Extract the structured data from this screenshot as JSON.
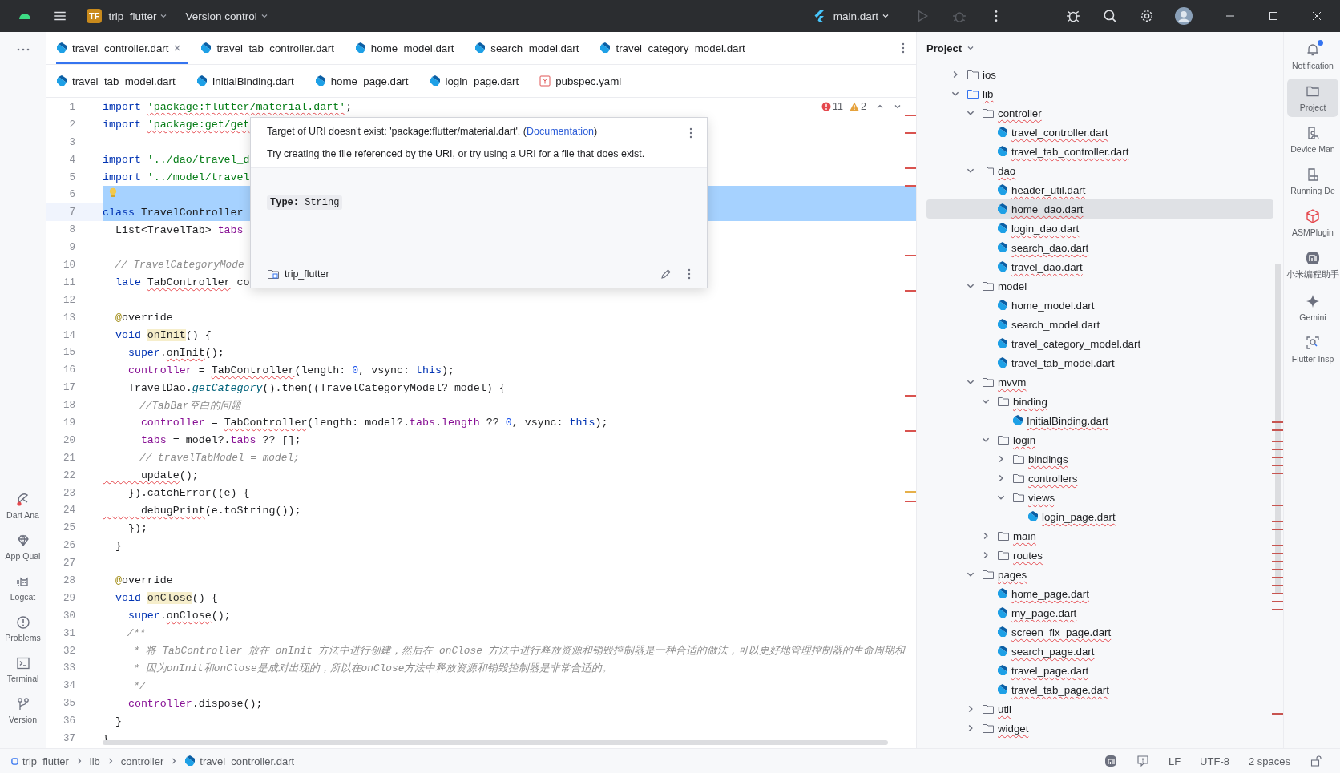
{
  "title_bar": {
    "project_badge": "TF",
    "project": "trip_flutter",
    "vcs": "Version control",
    "run_config": "main.dart"
  },
  "tab_rows": [
    {
      "tabs": [
        {
          "label": "travel_controller.dart",
          "kind": "dart",
          "selected": true
        },
        {
          "label": "travel_tab_controller.dart",
          "kind": "dart",
          "selected": false
        },
        {
          "label": "home_model.dart",
          "kind": "dart",
          "selected": false
        },
        {
          "label": "search_model.dart",
          "kind": "dart",
          "selected": false
        },
        {
          "label": "travel_category_model.dart",
          "kind": "dart",
          "selected": false
        }
      ]
    },
    {
      "tabs": [
        {
          "label": "travel_tab_model.dart",
          "kind": "dart",
          "selected": false
        },
        {
          "label": "InitialBinding.dart",
          "kind": "dart",
          "selected": false
        },
        {
          "label": "home_page.dart",
          "kind": "dart",
          "selected": false
        },
        {
          "label": "login_page.dart",
          "kind": "dart",
          "selected": false
        },
        {
          "label": "pubspec.yaml",
          "kind": "yaml",
          "selected": false
        }
      ]
    }
  ],
  "left_toolbar": [
    {
      "label": "Dart Ana",
      "kind": "analysis"
    },
    {
      "label": "App Qual",
      "kind": "quality"
    },
    {
      "label": "Logcat",
      "kind": "logcat"
    },
    {
      "label": "Problems",
      "kind": "problems"
    },
    {
      "label": "Terminal",
      "kind": "terminal"
    },
    {
      "label": "Version",
      "kind": "vcs"
    }
  ],
  "editor": {
    "problems": {
      "errors": "11",
      "warnings": "2"
    },
    "lines": [
      {
        "number": "1",
        "selected": false,
        "segments": [
          {
            "text": "import ",
            "kind": "keyword"
          },
          {
            "text": "'package:flutter/material.dart'",
            "kind": "string_error"
          },
          {
            "text": ";",
            "kind": "plain"
          }
        ]
      },
      {
        "number": "2",
        "selected": false,
        "segments": [
          {
            "text": "import ",
            "kind": "keyword"
          },
          {
            "text": "'package:get/get",
            "kind": "string_error"
          }
        ]
      },
      {
        "number": "3",
        "selected": false
      },
      {
        "number": "4",
        "selected": false,
        "segments": [
          {
            "text": "import",
            "kind": "keyword"
          },
          {
            "text": " '../dao/travel_d",
            "kind": "string"
          }
        ]
      },
      {
        "number": "5",
        "selected": false,
        "segments": [
          {
            "text": "import",
            "kind": "keyword"
          },
          {
            "text": " '../model/travel",
            "kind": "string"
          }
        ]
      },
      {
        "number": "6",
        "selected": true,
        "bulb": true
      },
      {
        "number": "7",
        "selected": true,
        "segments": [
          {
            "text": "class",
            "kind": "keyword"
          },
          {
            "text": " TravelController",
            "kind": "plain"
          }
        ]
      },
      {
        "number": "8",
        "selected": false,
        "segments": [
          {
            "text": "  List<TravelTab> ",
            "kind": "plain"
          },
          {
            "text": "tabs",
            "kind": "field"
          }
        ]
      },
      {
        "number": "9",
        "selected": false
      },
      {
        "number": "10",
        "selected": false,
        "segments": [
          {
            "text": "  // TravelCategoryMode",
            "kind": "comment"
          }
        ]
      },
      {
        "number": "11",
        "selected": false,
        "segments": [
          {
            "text": "  late ",
            "kind": "keyword"
          },
          {
            "text": "TabController",
            "kind": "plain_error"
          },
          {
            "text": " co",
            "kind": "plain"
          }
        ]
      },
      {
        "number": "12",
        "selected": false
      },
      {
        "number": "13",
        "selected": false,
        "segments": [
          {
            "text": "  @",
            "kind": "annotation"
          },
          {
            "text": "override",
            "kind": "plain"
          }
        ]
      },
      {
        "number": "14",
        "selected": false,
        "segments": [
          {
            "text": "  void ",
            "kind": "keyword"
          },
          {
            "text": "onInit",
            "kind": "usage"
          },
          {
            "text": "() {",
            "kind": "plain"
          }
        ]
      },
      {
        "number": "15",
        "selected": false,
        "segments": [
          {
            "text": "    super",
            "kind": "keyword"
          },
          {
            "text": ".",
            "kind": "plain"
          },
          {
            "text": "onInit",
            "kind": "plain_error"
          },
          {
            "text": "();",
            "kind": "plain"
          }
        ]
      },
      {
        "number": "16",
        "selected": false,
        "segments": [
          {
            "text": "    controller",
            "kind": "field"
          },
          {
            "text": " = ",
            "kind": "plain"
          },
          {
            "text": "TabController",
            "kind": "plain_error"
          },
          {
            "text": "(length: ",
            "kind": "plain"
          },
          {
            "text": "0",
            "kind": "number"
          },
          {
            "text": ", vsync: ",
            "kind": "plain"
          },
          {
            "text": "this",
            "kind": "keyword"
          },
          {
            "text": ");",
            "kind": "plain"
          }
        ]
      },
      {
        "number": "17",
        "selected": false,
        "segments": [
          {
            "text": "    TravelDao.",
            "kind": "plain"
          },
          {
            "text": "getCategory",
            "kind": "method"
          },
          {
            "text": "().then((TravelCategoryModel? model) {",
            "kind": "plain"
          }
        ]
      },
      {
        "number": "18",
        "selected": false,
        "segments": [
          {
            "text": "      //TabBar空白的问题",
            "kind": "comment"
          }
        ]
      },
      {
        "number": "19",
        "selected": false,
        "segments": [
          {
            "text": "      controller",
            "kind": "field"
          },
          {
            "text": " = ",
            "kind": "plain"
          },
          {
            "text": "TabController",
            "kind": "plain_error"
          },
          {
            "text": "(length: model?.",
            "kind": "plain"
          },
          {
            "text": "tabs",
            "kind": "field"
          },
          {
            "text": ".",
            "kind": "plain"
          },
          {
            "text": "length",
            "kind": "field"
          },
          {
            "text": " ?? ",
            "kind": "plain"
          },
          {
            "text": "0",
            "kind": "number"
          },
          {
            "text": ", vsync: ",
            "kind": "plain"
          },
          {
            "text": "this",
            "kind": "keyword"
          },
          {
            "text": ");",
            "kind": "plain"
          }
        ]
      },
      {
        "number": "20",
        "selected": false,
        "segments": [
          {
            "text": "      tabs",
            "kind": "field"
          },
          {
            "text": " = model?.",
            "kind": "plain"
          },
          {
            "text": "tabs",
            "kind": "field"
          },
          {
            "text": " ?? [];",
            "kind": "plain"
          }
        ]
      },
      {
        "number": "21",
        "selected": false,
        "segments": [
          {
            "text": "      // travelTabModel = model;",
            "kind": "comment"
          }
        ]
      },
      {
        "number": "22",
        "selected": false,
        "segments": [
          {
            "text": "      update",
            "kind": "plain_error"
          },
          {
            "text": "();",
            "kind": "plain"
          }
        ]
      },
      {
        "number": "23",
        "selected": false,
        "segments": [
          {
            "text": "    }).catchError((e) {",
            "kind": "plain"
          }
        ]
      },
      {
        "number": "24",
        "selected": false,
        "segments": [
          {
            "text": "      debugPrint",
            "kind": "plain_error"
          },
          {
            "text": "(e.toString());",
            "kind": "plain"
          }
        ]
      },
      {
        "number": "25",
        "selected": false,
        "segments": [
          {
            "text": "    });",
            "kind": "plain"
          }
        ]
      },
      {
        "number": "26",
        "selected": false,
        "segments": [
          {
            "text": "  }",
            "kind": "plain"
          }
        ]
      },
      {
        "number": "27",
        "selected": false
      },
      {
        "number": "28",
        "selected": false,
        "segments": [
          {
            "text": "  @",
            "kind": "annotation"
          },
          {
            "text": "override",
            "kind": "plain"
          }
        ]
      },
      {
        "number": "29",
        "selected": false,
        "segments": [
          {
            "text": "  void ",
            "kind": "keyword"
          },
          {
            "text": "onClose",
            "kind": "usage"
          },
          {
            "text": "() {",
            "kind": "plain"
          }
        ]
      },
      {
        "number": "30",
        "selected": false,
        "segments": [
          {
            "text": "    super",
            "kind": "keyword"
          },
          {
            "text": ".",
            "kind": "plain"
          },
          {
            "text": "onClose",
            "kind": "plain_error"
          },
          {
            "text": "();",
            "kind": "plain"
          }
        ]
      },
      {
        "number": "31",
        "selected": false,
        "segments": [
          {
            "text": "    /**",
            "kind": "comment"
          }
        ]
      },
      {
        "number": "32",
        "selected": false,
        "segments": [
          {
            "text": "     * 将 TabController 放在 onInit 方法中进行创建，然后在 onClose 方法中进行释放资源和销毁控制器是一种合适的做法，可以更好地管理控制器的生命周期和",
            "kind": "comment"
          }
        ]
      },
      {
        "number": "33",
        "selected": false,
        "segments": [
          {
            "text": "     * 因为onInit和onClose是成对出现的，所以在onClose方法中释放资源和销毁控制器是非常合适的。",
            "kind": "comment"
          }
        ]
      },
      {
        "number": "34",
        "selected": false,
        "segments": [
          {
            "text": "     */",
            "kind": "comment"
          }
        ]
      },
      {
        "number": "35",
        "selected": false,
        "segments": [
          {
            "text": "    controller",
            "kind": "field"
          },
          {
            "text": ".dispose();",
            "kind": "plain"
          }
        ]
      },
      {
        "number": "36",
        "selected": false,
        "segments": [
          {
            "text": "  }",
            "kind": "plain"
          }
        ]
      },
      {
        "number": "37",
        "selected": false,
        "segments": [
          {
            "text": "}",
            "kind": "plain"
          }
        ]
      }
    ],
    "popup": {
      "message": "Target of URI doesn't exist: 'package:flutter/material.dart'. (",
      "link": "Documentation",
      "message_end": ")",
      "hint": "Try creating the file referenced by the URI, or try using a URI for a file that does exist.",
      "type_label": "Type:",
      "type_value": "String",
      "project": "trip_flutter"
    }
  },
  "project_panel": {
    "title": "Project",
    "tree": [
      {
        "label": "ios",
        "kind": "folder",
        "expanded": false,
        "error": false,
        "selected": false
      },
      {
        "label": "lib",
        "kind": "source_folder",
        "expanded": true,
        "error": true,
        "selected": false,
        "children": [
          {
            "label": "controller",
            "kind": "folder",
            "expanded": true,
            "error": true,
            "selected": false,
            "children": [
              {
                "label": "travel_controller.dart",
                "kind": "dart",
                "error": true,
                "selected": false
              },
              {
                "label": "travel_tab_controller.dart",
                "kind": "dart",
                "error": true,
                "selected": false
              }
            ]
          },
          {
            "label": "dao",
            "kind": "folder",
            "expanded": true,
            "error": true,
            "selected": false,
            "children": [
              {
                "label": "header_util.dart",
                "kind": "dart",
                "error": true,
                "selected": false
              },
              {
                "label": "home_dao.dart",
                "kind": "dart",
                "error": true,
                "selected": true
              },
              {
                "label": "login_dao.dart",
                "kind": "dart",
                "error": true,
                "selected": false
              },
              {
                "label": "search_dao.dart",
                "kind": "dart",
                "error": true,
                "selected": false
              },
              {
                "label": "travel_dao.dart",
                "kind": "dart",
                "error": true,
                "selected": false
              }
            ]
          },
          {
            "label": "model",
            "kind": "folder",
            "expanded": true,
            "error": false,
            "selected": false,
            "children": [
              {
                "label": "home_model.dart",
                "kind": "dart",
                "error": false,
                "selected": false
              },
              {
                "label": "search_model.dart",
                "kind": "dart",
                "error": false,
                "selected": false
              },
              {
                "label": "travel_category_model.dart",
                "kind": "dart",
                "error": false,
                "selected": false
              },
              {
                "label": "travel_tab_model.dart",
                "kind": "dart",
                "error": false,
                "selected": false
              }
            ]
          },
          {
            "label": "mvvm",
            "kind": "folder",
            "expanded": true,
            "error": true,
            "selected": false,
            "children": [
              {
                "label": "binding",
                "kind": "folder",
                "expanded": true,
                "error": true,
                "selected": false,
                "children": [
                  {
                    "label": "InitialBinding.dart",
                    "kind": "dart",
                    "error": true,
                    "selected": false
                  }
                ]
              },
              {
                "label": "login",
                "kind": "folder",
                "expanded": true,
                "error": true,
                "selected": false,
                "children": [
                  {
                    "label": "bindings",
                    "kind": "folder",
                    "expanded": false,
                    "error": true,
                    "selected": false
                  },
                  {
                    "label": "controllers",
                    "kind": "folder",
                    "expanded": false,
                    "error": true,
                    "selected": false
                  },
                  {
                    "label": "views",
                    "kind": "folder",
                    "expanded": true,
                    "error": true,
                    "selected": false,
                    "children": [
                      {
                        "label": "login_page.dart",
                        "kind": "dart",
                        "error": true,
                        "selected": false
                      }
                    ]
                  }
                ]
              },
              {
                "label": "main",
                "kind": "folder",
                "expanded": false,
                "error": true,
                "selected": false
              },
              {
                "label": "routes",
                "kind": "folder",
                "expanded": false,
                "error": true,
                "selected": false
              }
            ]
          },
          {
            "label": "pages",
            "kind": "folder",
            "expanded": true,
            "error": true,
            "selected": false,
            "children": [
              {
                "label": "home_page.dart",
                "kind": "dart",
                "error": true,
                "selected": false
              },
              {
                "label": "my_page.dart",
                "kind": "dart",
                "error": true,
                "selected": false
              },
              {
                "label": "screen_fix_page.dart",
                "kind": "dart",
                "error": true,
                "selected": false
              },
              {
                "label": "search_page.dart",
                "kind": "dart",
                "error": true,
                "selected": false
              },
              {
                "label": "travel_page.dart",
                "kind": "dart",
                "error": true,
                "selected": false
              },
              {
                "label": "travel_tab_page.dart",
                "kind": "dart",
                "error": true,
                "selected": false
              }
            ]
          },
          {
            "label": "util",
            "kind": "folder",
            "expanded": false,
            "error": true,
            "selected": false
          },
          {
            "label": "widget",
            "kind": "folder",
            "expanded": false,
            "error": true,
            "selected": false
          }
        ]
      }
    ]
  },
  "right_toolbar": [
    {
      "label": "Notification",
      "kind": "bell",
      "selected": false,
      "unread": true
    },
    {
      "label": "Project",
      "kind": "folder",
      "selected": true,
      "unread": false
    },
    {
      "label": "Device Man",
      "kind": "device",
      "selected": false,
      "unread": false
    },
    {
      "label": "Running De",
      "kind": "running",
      "selected": false,
      "unread": false
    },
    {
      "label": "ASMPlugin",
      "kind": "cube",
      "selected": false,
      "unread": false
    },
    {
      "label": "小米编程助手",
      "kind": "mi",
      "selected": false,
      "unread": false
    },
    {
      "label": "Gemini",
      "kind": "sparkle",
      "selected": false,
      "unread": false
    },
    {
      "label": "Flutter Insp",
      "kind": "inspect",
      "selected": false,
      "unread": false
    }
  ],
  "status_bar": {
    "breadcrumbs": [
      {
        "label": "trip_flutter",
        "kind": "module"
      },
      {
        "label": "lib",
        "kind": "none"
      },
      {
        "label": "controller",
        "kind": "none"
      },
      {
        "label": "travel_controller.dart",
        "kind": "dart"
      }
    ],
    "line_separator": "LF",
    "encoding": "UTF-8",
    "indent": "2 spaces"
  }
}
